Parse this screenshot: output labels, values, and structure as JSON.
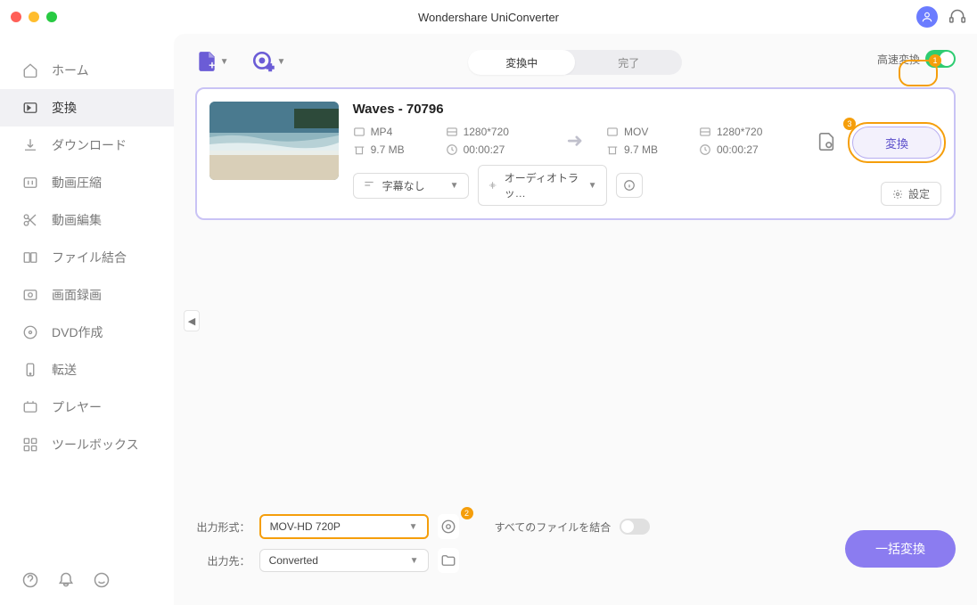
{
  "app": {
    "title": "Wondershare UniConverter"
  },
  "sidebar": {
    "items": [
      {
        "label": "ホーム"
      },
      {
        "label": "変換"
      },
      {
        "label": "ダウンロード"
      },
      {
        "label": "動画圧縮"
      },
      {
        "label": "動画編集"
      },
      {
        "label": "ファイル結合"
      },
      {
        "label": "画面録画"
      },
      {
        "label": "DVD作成"
      },
      {
        "label": "転送"
      },
      {
        "label": "プレヤー"
      },
      {
        "label": "ツールボックス"
      }
    ]
  },
  "tabs": {
    "converting": "変換中",
    "done": "完了"
  },
  "topRight": {
    "fastConvert": "高速変換",
    "badge": "1"
  },
  "file": {
    "title": "Waves - 70796",
    "src": {
      "format": "MP4",
      "resolution": "1280*720",
      "size": "9.7 MB",
      "duration": "00:00:27"
    },
    "dst": {
      "format": "MOV",
      "resolution": "1280*720",
      "size": "9.7 MB",
      "duration": "00:00:27"
    },
    "subtitle": "字幕なし",
    "audio": "オーディオトラッ…",
    "convert": "変換",
    "convertBadge": "3",
    "settings": "設定"
  },
  "bottom": {
    "formatLabel": "出力形式：",
    "formatValue": "MOV-HD 720P",
    "formatBadge": "2",
    "destLabel": "出力先：",
    "destValue": "Converted",
    "mergeLabel": "すべてのファイルを結合",
    "batch": "一括変換"
  }
}
